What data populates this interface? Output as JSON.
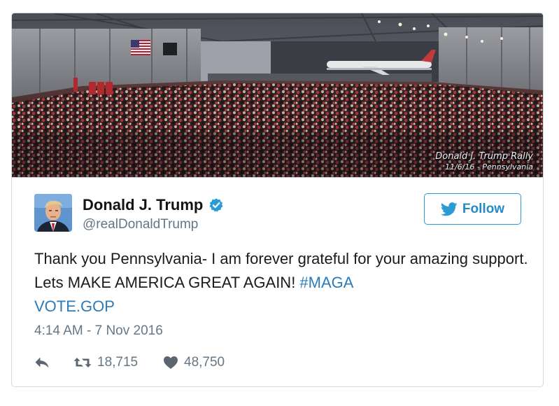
{
  "photo": {
    "caption_line1": "Donald J. Trump Rally",
    "caption_line2": "11/6/16 - Pennsylvania"
  },
  "author": {
    "name": "Donald J. Trump",
    "handle": "@realDonaldTrump",
    "verified": true
  },
  "follow_button": {
    "label": "Follow",
    "icon": "twitter-bird-icon"
  },
  "tweet": {
    "text_part1": "Thank you Pennsylvania- I am forever grateful for your amazing support. Lets MAKE AMERICA GREAT AGAIN! ",
    "hashtag": "#MAGA",
    "link": "VOTE.GOP"
  },
  "timestamp": "4:14 AM - 7 Nov 2016",
  "actions": {
    "reply_icon": "reply-icon",
    "retweets": "18,715",
    "likes": "48,750"
  },
  "colors": {
    "link": "#2b7bb9",
    "follow": "#2789c5",
    "verified": "#2b9bd6",
    "muted": "#657786"
  }
}
